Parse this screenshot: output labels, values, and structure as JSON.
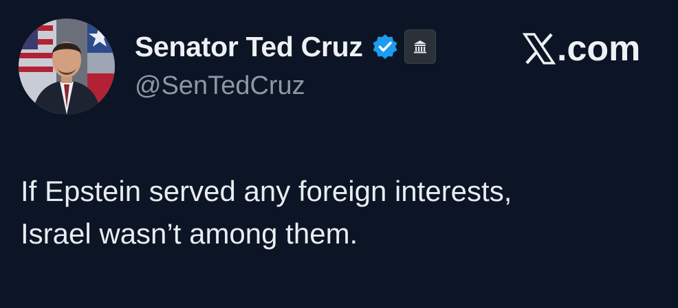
{
  "tweet": {
    "display_name": "Senator Ted Cruz",
    "handle": "@SenTedCruz",
    "text": "If Epstein served any foreign interests,\nIsrael wasn’t among them.",
    "verified": true,
    "affiliation_badge": "government-building-icon"
  },
  "brand": {
    "logo_icon": "x-logo-icon",
    "suffix": ".com"
  },
  "colors": {
    "background": "#0c1525",
    "verified_badge": "#1d9bf0",
    "text_primary": "#e7e9ea",
    "text_secondary": "#8b98a5"
  }
}
